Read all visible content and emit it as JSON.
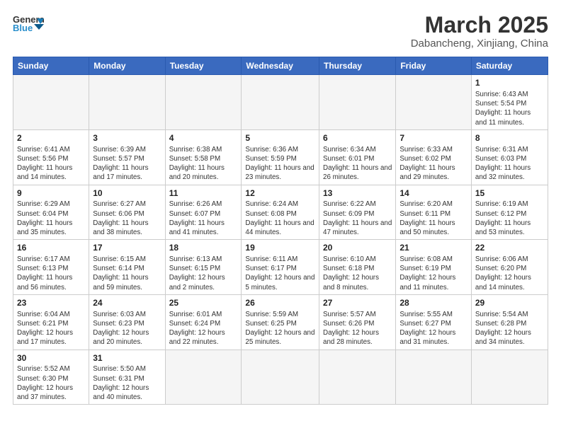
{
  "header": {
    "logo_general": "General",
    "logo_blue": "Blue",
    "month_year": "March 2025",
    "location": "Dabancheng, Xinjiang, China"
  },
  "weekdays": [
    "Sunday",
    "Monday",
    "Tuesday",
    "Wednesday",
    "Thursday",
    "Friday",
    "Saturday"
  ],
  "rows": [
    [
      {
        "day": "",
        "info": ""
      },
      {
        "day": "",
        "info": ""
      },
      {
        "day": "",
        "info": ""
      },
      {
        "day": "",
        "info": ""
      },
      {
        "day": "",
        "info": ""
      },
      {
        "day": "",
        "info": ""
      },
      {
        "day": "1",
        "info": "Sunrise: 6:43 AM\nSunset: 5:54 PM\nDaylight: 11 hours and 11 minutes."
      }
    ],
    [
      {
        "day": "2",
        "info": "Sunrise: 6:41 AM\nSunset: 5:56 PM\nDaylight: 11 hours and 14 minutes."
      },
      {
        "day": "3",
        "info": "Sunrise: 6:39 AM\nSunset: 5:57 PM\nDaylight: 11 hours and 17 minutes."
      },
      {
        "day": "4",
        "info": "Sunrise: 6:38 AM\nSunset: 5:58 PM\nDaylight: 11 hours and 20 minutes."
      },
      {
        "day": "5",
        "info": "Sunrise: 6:36 AM\nSunset: 5:59 PM\nDaylight: 11 hours and 23 minutes."
      },
      {
        "day": "6",
        "info": "Sunrise: 6:34 AM\nSunset: 6:01 PM\nDaylight: 11 hours and 26 minutes."
      },
      {
        "day": "7",
        "info": "Sunrise: 6:33 AM\nSunset: 6:02 PM\nDaylight: 11 hours and 29 minutes."
      },
      {
        "day": "8",
        "info": "Sunrise: 6:31 AM\nSunset: 6:03 PM\nDaylight: 11 hours and 32 minutes."
      }
    ],
    [
      {
        "day": "9",
        "info": "Sunrise: 6:29 AM\nSunset: 6:04 PM\nDaylight: 11 hours and 35 minutes."
      },
      {
        "day": "10",
        "info": "Sunrise: 6:27 AM\nSunset: 6:06 PM\nDaylight: 11 hours and 38 minutes."
      },
      {
        "day": "11",
        "info": "Sunrise: 6:26 AM\nSunset: 6:07 PM\nDaylight: 11 hours and 41 minutes."
      },
      {
        "day": "12",
        "info": "Sunrise: 6:24 AM\nSunset: 6:08 PM\nDaylight: 11 hours and 44 minutes."
      },
      {
        "day": "13",
        "info": "Sunrise: 6:22 AM\nSunset: 6:09 PM\nDaylight: 11 hours and 47 minutes."
      },
      {
        "day": "14",
        "info": "Sunrise: 6:20 AM\nSunset: 6:11 PM\nDaylight: 11 hours and 50 minutes."
      },
      {
        "day": "15",
        "info": "Sunrise: 6:19 AM\nSunset: 6:12 PM\nDaylight: 11 hours and 53 minutes."
      }
    ],
    [
      {
        "day": "16",
        "info": "Sunrise: 6:17 AM\nSunset: 6:13 PM\nDaylight: 11 hours and 56 minutes."
      },
      {
        "day": "17",
        "info": "Sunrise: 6:15 AM\nSunset: 6:14 PM\nDaylight: 11 hours and 59 minutes."
      },
      {
        "day": "18",
        "info": "Sunrise: 6:13 AM\nSunset: 6:15 PM\nDaylight: 12 hours and 2 minutes."
      },
      {
        "day": "19",
        "info": "Sunrise: 6:11 AM\nSunset: 6:17 PM\nDaylight: 12 hours and 5 minutes."
      },
      {
        "day": "20",
        "info": "Sunrise: 6:10 AM\nSunset: 6:18 PM\nDaylight: 12 hours and 8 minutes."
      },
      {
        "day": "21",
        "info": "Sunrise: 6:08 AM\nSunset: 6:19 PM\nDaylight: 12 hours and 11 minutes."
      },
      {
        "day": "22",
        "info": "Sunrise: 6:06 AM\nSunset: 6:20 PM\nDaylight: 12 hours and 14 minutes."
      }
    ],
    [
      {
        "day": "23",
        "info": "Sunrise: 6:04 AM\nSunset: 6:21 PM\nDaylight: 12 hours and 17 minutes."
      },
      {
        "day": "24",
        "info": "Sunrise: 6:03 AM\nSunset: 6:23 PM\nDaylight: 12 hours and 20 minutes."
      },
      {
        "day": "25",
        "info": "Sunrise: 6:01 AM\nSunset: 6:24 PM\nDaylight: 12 hours and 22 minutes."
      },
      {
        "day": "26",
        "info": "Sunrise: 5:59 AM\nSunset: 6:25 PM\nDaylight: 12 hours and 25 minutes."
      },
      {
        "day": "27",
        "info": "Sunrise: 5:57 AM\nSunset: 6:26 PM\nDaylight: 12 hours and 28 minutes."
      },
      {
        "day": "28",
        "info": "Sunrise: 5:55 AM\nSunset: 6:27 PM\nDaylight: 12 hours and 31 minutes."
      },
      {
        "day": "29",
        "info": "Sunrise: 5:54 AM\nSunset: 6:28 PM\nDaylight: 12 hours and 34 minutes."
      }
    ],
    [
      {
        "day": "30",
        "info": "Sunrise: 5:52 AM\nSunset: 6:30 PM\nDaylight: 12 hours and 37 minutes."
      },
      {
        "day": "31",
        "info": "Sunrise: 5:50 AM\nSunset: 6:31 PM\nDaylight: 12 hours and 40 minutes."
      },
      {
        "day": "",
        "info": ""
      },
      {
        "day": "",
        "info": ""
      },
      {
        "day": "",
        "info": ""
      },
      {
        "day": "",
        "info": ""
      },
      {
        "day": "",
        "info": ""
      }
    ]
  ]
}
